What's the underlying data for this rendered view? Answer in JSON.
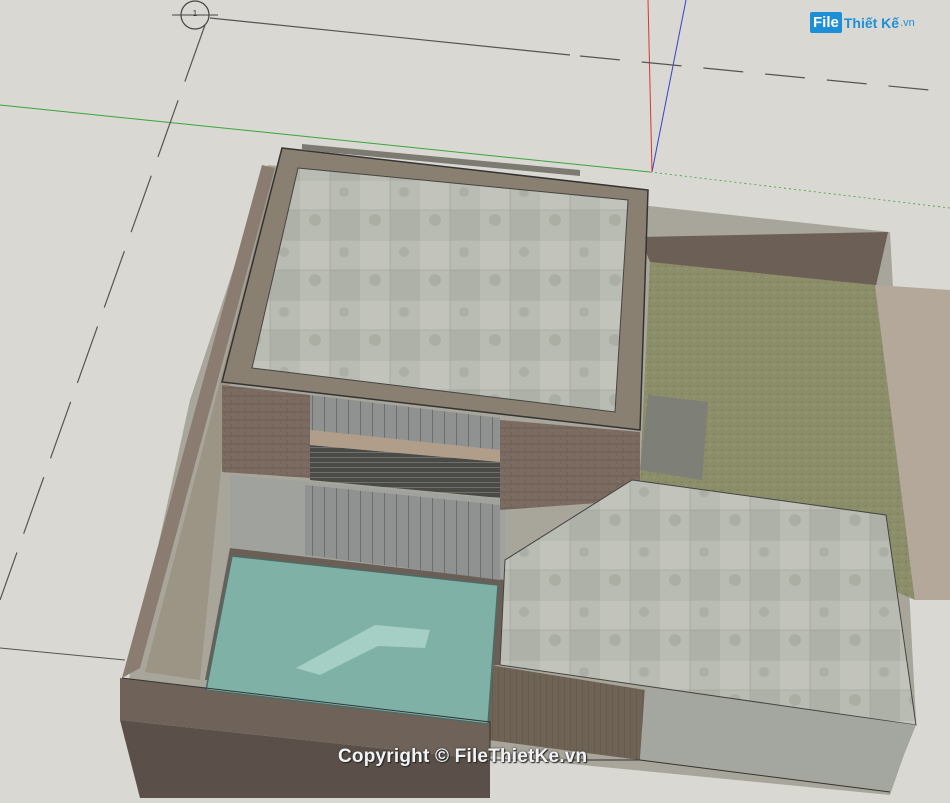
{
  "scene": {
    "section_marker_label": "1"
  },
  "branding": {
    "logo_badge": "File",
    "logo_text": "Thiết Kế",
    "logo_suffix": ".vn",
    "watermark": "Copyright © FileThietKe.vn"
  },
  "colors": {
    "background": "#d9d8d3",
    "green_axis": "#3aa53a",
    "red_axis": "#d33",
    "blue_axis": "#3344cc",
    "concrete": "#b7b9b1",
    "brick": "#7a6a60",
    "grass": "#8c8f6a",
    "pool_water": "#7fb2a8",
    "wall_top": "#8a8072"
  }
}
